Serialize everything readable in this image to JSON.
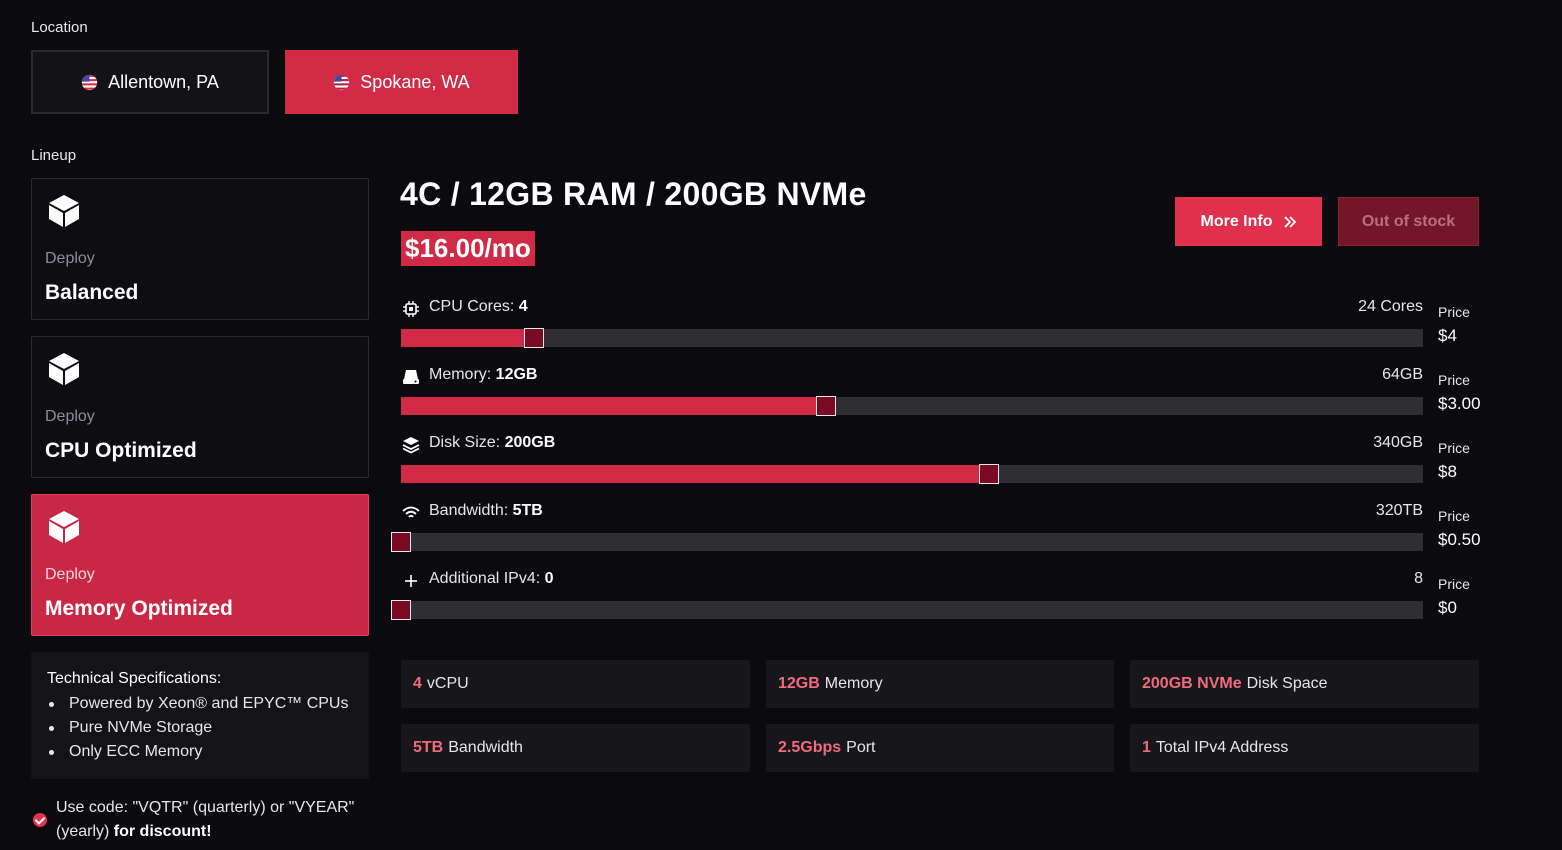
{
  "location": {
    "label": "Location",
    "options": [
      {
        "label": "Allentown, PA",
        "flag": "us-flag-icon",
        "active": false
      },
      {
        "label": "Spokane, WA",
        "flag": "us-flag-icon",
        "active": true
      }
    ]
  },
  "lineup": {
    "label": "Lineup",
    "items": [
      {
        "deploy": "Deploy",
        "name": "Balanced",
        "icon": "cube-icon",
        "active": false
      },
      {
        "deploy": "Deploy",
        "name": "CPU Optimized",
        "icon": "cube-icon",
        "active": false
      },
      {
        "deploy": "Deploy",
        "name": "Memory Optimized",
        "icon": "cube-icon",
        "active": true
      }
    ]
  },
  "specs": {
    "title": "Technical Specifications:",
    "items": [
      "Powered by Xeon® and EPYC™ CPUs",
      "Pure NVMe Storage",
      "Only ECC Memory"
    ]
  },
  "promo": {
    "text": "Use code: \"VQTR\" (quarterly) or \"VYEAR\" (yearly) ",
    "bold": "for discount!"
  },
  "plan": {
    "title": "4C / 12GB RAM / 200GB NVMe",
    "price": "$16.00/mo",
    "more_info": "More Info",
    "out_of_stock": "Out of stock"
  },
  "sliders": [
    {
      "icon": "cpu-icon",
      "label": "CPU Cores: ",
      "value": "4",
      "max": "24 Cores",
      "price_label": "Price",
      "price": "$4",
      "fraction": 0.13
    },
    {
      "icon": "memory-icon",
      "label": "Memory: ",
      "value": "12GB",
      "max": "64GB",
      "price_label": "Price",
      "price": "$3.00",
      "fraction": 0.416
    },
    {
      "icon": "layers-icon",
      "label": "Disk Size: ",
      "value": "200GB",
      "max": "340GB",
      "price_label": "Price",
      "price": "$8",
      "fraction": 0.575
    },
    {
      "icon": "wifi-icon",
      "label": "Bandwidth: ",
      "value": "5TB",
      "max": "320TB",
      "price_label": "Price",
      "price": "$0.50",
      "fraction": 0
    },
    {
      "icon": "plus-icon",
      "label": "Additional IPv4: ",
      "value": "0",
      "max": "8",
      "price_label": "Price",
      "price": "$0",
      "fraction": 0
    }
  ],
  "features": [
    {
      "hl": "4",
      "text": "vCPU"
    },
    {
      "hl": "12GB",
      "text": "Memory"
    },
    {
      "hl": "200GB NVMe",
      "text": "Disk Space"
    },
    {
      "hl": "5TB",
      "text": "Bandwidth"
    },
    {
      "hl": "2.5Gbps",
      "text": "Port"
    },
    {
      "hl": "1",
      "text": "Total IPv4 Address"
    }
  ],
  "colors": {
    "accent": "#d12a47",
    "thumb": "#7a0a24",
    "background": "#0b0b0f"
  }
}
